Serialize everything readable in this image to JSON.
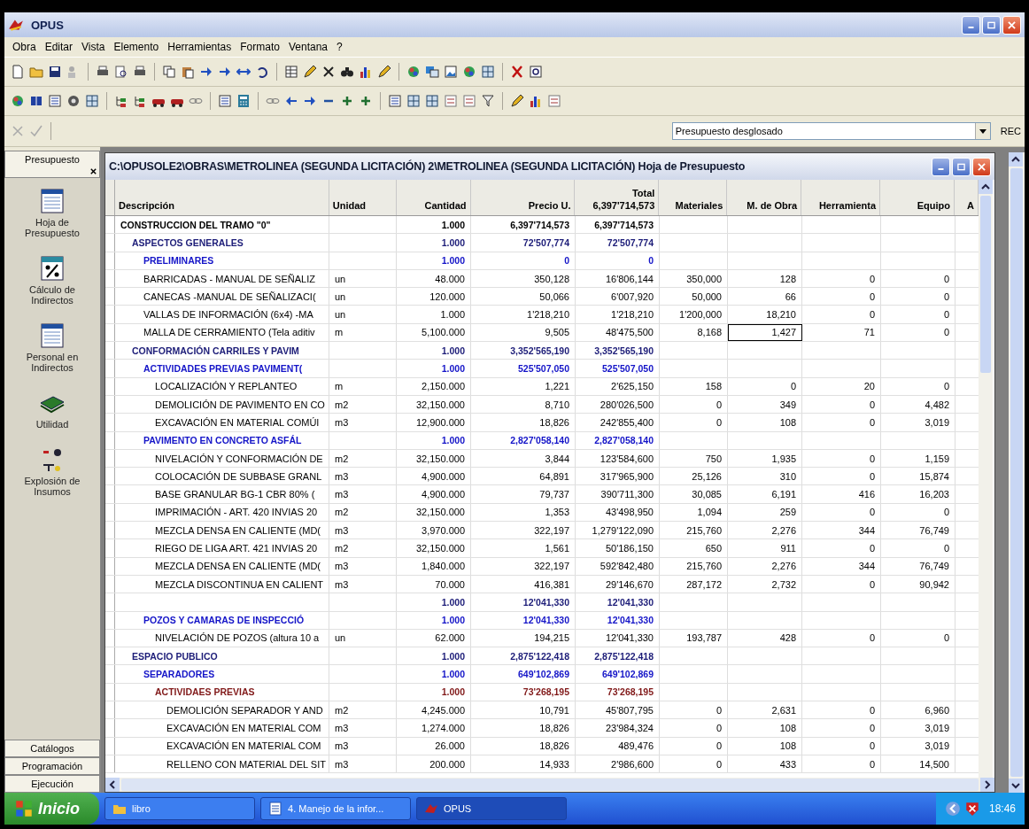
{
  "window": {
    "title": "OPUS"
  },
  "menu": [
    "Obra",
    "Editar",
    "Vista",
    "Elemento",
    "Herramientas",
    "Formato",
    "Ventana",
    "?"
  ],
  "view_selector": {
    "value": "Presupuesto desglosado"
  },
  "rec_label": "REC",
  "sidebar": {
    "top_tab": "Presupuesto",
    "items": [
      {
        "label": "Hoja de Presupuesto",
        "kind": "sheet"
      },
      {
        "label": "Cálculo de Indirectos",
        "kind": "percent"
      },
      {
        "label": "Personal en Indirectos",
        "kind": "sheet"
      },
      {
        "label": "Utilidad",
        "kind": "money"
      },
      {
        "label": "Explosión de Insumos",
        "kind": "explode"
      }
    ],
    "bottom_tabs": [
      "Catálogos",
      "Programación",
      "Ejecución"
    ]
  },
  "document": {
    "title": "C:\\OPUSOLE2\\OBRAS\\METROLINEA (SEGUNDA LICITACIÓN) 2\\METROLINEA (SEGUNDA LICITACIÓN) Hoja de Presupuesto",
    "columns": [
      {
        "label": "Descripción"
      },
      {
        "label": "Unidad"
      },
      {
        "label": "Cantidad"
      },
      {
        "label": "Precio U."
      },
      {
        "label": "Total",
        "subtotal": "6,397'714,573"
      },
      {
        "label": "Materiales"
      },
      {
        "label": "M. de Obra"
      },
      {
        "label": "Herramienta"
      },
      {
        "label": "Equipo"
      },
      {
        "label": "A"
      }
    ],
    "rows": [
      {
        "kind": "group",
        "color": "#000000",
        "descripcion": "CONSTRUCCION DEL TRAMO \"0\"",
        "cantidad": "1.000",
        "precio": "6,397'714,573",
        "total": "6,397'714,573",
        "children": [
          {
            "kind": "group",
            "color": "#1c1c78",
            "descripcion": "ASPECTOS GENERALES",
            "cantidad": "1.000",
            "precio": "72'507,774",
            "total": "72'507,774",
            "children": [
              {
                "kind": "group",
                "color": "#1414c8",
                "descripcion": "PRELIMINARES",
                "cantidad": "1.000",
                "precio": "0",
                "total": "0"
              },
              {
                "kind": "item",
                "descripcion": "BARRICADAS - MANUAL DE SEÑALIZ",
                "unidad": "un",
                "cantidad": "48.000",
                "precio": "350,128",
                "total": "16'806,144",
                "materiales": "350,000",
                "mano_obra": "128",
                "herramienta": "0",
                "equipo": "0",
                "mano_obra_focused": false
              },
              {
                "kind": "item",
                "descripcion": "CANECAS -MANUAL DE SEÑALIZACI(",
                "unidad": "un",
                "cantidad": "120.000",
                "precio": "50,066",
                "total": "6'007,920",
                "materiales": "50,000",
                "mano_obra": "66",
                "herramienta": "0",
                "equipo": "0",
                "mano_obra_focused": false
              },
              {
                "kind": "item",
                "descripcion": "VALLAS DE INFORMACIÓN (6x4) -MA",
                "unidad": "un",
                "cantidad": "1.000",
                "precio": "1'218,210",
                "total": "1'218,210",
                "materiales": "1'200,000",
                "mano_obra": "18,210",
                "herramienta": "0",
                "equipo": "0",
                "mano_obra_focused": false
              },
              {
                "kind": "item",
                "descripcion": "MALLA DE CERRAMIENTO (Tela aditiv",
                "unidad": "m",
                "cantidad": "5,100.000",
                "precio": "9,505",
                "total": "48'475,500",
                "materiales": "8,168",
                "mano_obra": "1,427",
                "herramienta": "71",
                "equipo": "0",
                "mano_obra_focused": true
              }
            ]
          },
          {
            "kind": "group",
            "color": "#1c1c78",
            "descripcion": "CONFORMACIÓN CARRILES Y PAVIM",
            "cantidad": "1.000",
            "precio": "3,352'565,190",
            "total": "3,352'565,190",
            "children": [
              {
                "kind": "group",
                "color": "#1414c8",
                "descripcion": "ACTIVIDADES PREVIAS PAVIMENT(",
                "cantidad": "1.000",
                "precio": "525'507,050",
                "total": "525'507,050",
                "children": [
                  {
                    "kind": "item",
                    "descripcion": "LOCALIZACIÓN Y REPLANTEO",
                    "unidad": "m",
                    "cantidad": "2,150.000",
                    "precio": "1,221",
                    "total": "2'625,150",
                    "materiales": "158",
                    "mano_obra": "0",
                    "herramienta": "20",
                    "equipo": "0",
                    "mano_obra_focused": false
                  },
                  {
                    "kind": "item",
                    "descripcion": "DEMOLICIÓN DE PAVIMENTO EN CO",
                    "unidad": "m2",
                    "cantidad": "32,150.000",
                    "precio": "8,710",
                    "total": "280'026,500",
                    "materiales": "0",
                    "mano_obra": "349",
                    "herramienta": "0",
                    "equipo": "4,482",
                    "mano_obra_focused": false
                  },
                  {
                    "kind": "item",
                    "descripcion": "EXCAVACIÓN EN MATERIAL COMÚI",
                    "unidad": "m3",
                    "cantidad": "12,900.000",
                    "precio": "18,826",
                    "total": "242'855,400",
                    "materiales": "0",
                    "mano_obra": "108",
                    "herramienta": "0",
                    "equipo": "3,019",
                    "mano_obra_focused": false
                  }
                ]
              },
              {
                "kind": "group",
                "color": "#1414c8",
                "descripcion": "PAVIMENTO EN CONCRETO ASFÁL",
                "cantidad": "1.000",
                "precio": "2,827'058,140",
                "total": "2,827'058,140",
                "children": [
                  {
                    "kind": "item",
                    "descripcion": "NIVELACIÓN Y CONFORMACIÓN DE",
                    "unidad": "m2",
                    "cantidad": "32,150.000",
                    "precio": "3,844",
                    "total": "123'584,600",
                    "materiales": "750",
                    "mano_obra": "1,935",
                    "herramienta": "0",
                    "equipo": "1,159",
                    "mano_obra_focused": false
                  },
                  {
                    "kind": "item",
                    "descripcion": "COLOCACIÓN DE SUBBASE GRANL",
                    "unidad": "m3",
                    "cantidad": "4,900.000",
                    "precio": "64,891",
                    "total": "317'965,900",
                    "materiales": "25,126",
                    "mano_obra": "310",
                    "herramienta": "0",
                    "equipo": "15,874",
                    "mano_obra_focused": false
                  },
                  {
                    "kind": "item",
                    "descripcion": "BASE GRANULAR BG-1 CBR 80% (",
                    "unidad": "m3",
                    "cantidad": "4,900.000",
                    "precio": "79,737",
                    "total": "390'711,300",
                    "materiales": "30,085",
                    "mano_obra": "6,191",
                    "herramienta": "416",
                    "equipo": "16,203",
                    "mano_obra_focused": false
                  },
                  {
                    "kind": "item",
                    "descripcion": "IMPRIMACIÓN - ART. 420 INVIAS 20",
                    "unidad": "m2",
                    "cantidad": "32,150.000",
                    "precio": "1,353",
                    "total": "43'498,950",
                    "materiales": "1,094",
                    "mano_obra": "259",
                    "herramienta": "0",
                    "equipo": "0",
                    "mano_obra_focused": false
                  },
                  {
                    "kind": "item",
                    "descripcion": "MEZCLA DENSA EN CALIENTE (MD(",
                    "unidad": "m3",
                    "cantidad": "3,970.000",
                    "precio": "322,197",
                    "total": "1,279'122,090",
                    "materiales": "215,760",
                    "mano_obra": "2,276",
                    "herramienta": "344",
                    "equipo": "76,749",
                    "mano_obra_focused": false
                  },
                  {
                    "kind": "item",
                    "descripcion": "RIEGO DE LIGA ART. 421 INVIAS 20",
                    "unidad": "m2",
                    "cantidad": "32,150.000",
                    "precio": "1,561",
                    "total": "50'186,150",
                    "materiales": "650",
                    "mano_obra": "911",
                    "herramienta": "0",
                    "equipo": "0",
                    "mano_obra_focused": false
                  },
                  {
                    "kind": "item",
                    "descripcion": "MEZCLA DENSA EN CALIENTE (MD(",
                    "unidad": "m3",
                    "cantidad": "1,840.000",
                    "precio": "322,197",
                    "total": "592'842,480",
                    "materiales": "215,760",
                    "mano_obra": "2,276",
                    "herramienta": "344",
                    "equipo": "76,749",
                    "mano_obra_focused": false
                  },
                  {
                    "kind": "item",
                    "descripcion": "MEZCLA DISCONTINUA EN CALIENT",
                    "unidad": "m3",
                    "cantidad": "70.000",
                    "precio": "416,381",
                    "total": "29'146,670",
                    "materiales": "287,172",
                    "mano_obra": "2,732",
                    "herramienta": "0",
                    "equipo": "90,942",
                    "mano_obra_focused": false
                  }
                ]
              }
            ]
          },
          {
            "kind": "group",
            "color": "#1c1c78",
            "cantidad": "1.000",
            "precio": "12'041,330",
            "total": "12'041,330",
            "children": [
              {
                "kind": "group",
                "color": "#1414c8",
                "descripcion": "POZOS Y CAMARAS DE INSPECCIÓ",
                "cantidad": "1.000",
                "precio": "12'041,330",
                "total": "12'041,330",
                "children": [
                  {
                    "kind": "item",
                    "descripcion": "NIVELACIÓN DE POZOS (altura 10 a",
                    "unidad": "un",
                    "cantidad": "62.000",
                    "precio": "194,215",
                    "total": "12'041,330",
                    "materiales": "193,787",
                    "mano_obra": "428",
                    "herramienta": "0",
                    "equipo": "0",
                    "mano_obra_focused": false
                  }
                ]
              }
            ]
          },
          {
            "kind": "group",
            "color": "#1c1c78",
            "descripcion": "ESPACIO PUBLICO",
            "cantidad": "1.000",
            "precio": "2,875'122,418",
            "total": "2,875'122,418",
            "children": [
              {
                "kind": "group",
                "color": "#1414c8",
                "descripcion": "SEPARADORES",
                "cantidad": "1.000",
                "precio": "649'102,869",
                "total": "649'102,869",
                "children": [
                  {
                    "kind": "group",
                    "color": "#801818",
                    "descripcion": "ACTIVIDAES PREVIAS",
                    "cantidad": "1.000",
                    "precio": "73'268,195",
                    "total": "73'268,195",
                    "children": [
                      {
                        "kind": "item",
                        "descripcion": "DEMOLICIÓN SEPARADOR Y AND",
                        "unidad": "m2",
                        "cantidad": "4,245.000",
                        "precio": "10,791",
                        "total": "45'807,795",
                        "materiales": "0",
                        "mano_obra": "2,631",
                        "herramienta": "0",
                        "equipo": "6,960",
                        "mano_obra_focused": false
                      },
                      {
                        "kind": "item",
                        "descripcion": "EXCAVACIÓN EN MATERIAL COM",
                        "unidad": "m3",
                        "cantidad": "1,274.000",
                        "precio": "18,826",
                        "total": "23'984,324",
                        "materiales": "0",
                        "mano_obra": "108",
                        "herramienta": "0",
                        "equipo": "3,019",
                        "mano_obra_focused": false
                      },
                      {
                        "kind": "item",
                        "descripcion": "EXCAVACIÓN EN MATERIAL COM",
                        "unidad": "m3",
                        "cantidad": "26.000",
                        "precio": "18,826",
                        "total": "489,476",
                        "materiales": "0",
                        "mano_obra": "108",
                        "herramienta": "0",
                        "equipo": "3,019",
                        "mano_obra_focused": false
                      },
                      {
                        "kind": "item",
                        "descripcion": "RELLENO CON MATERIAL DEL SIT",
                        "unidad": "m3",
                        "cantidad": "200.000",
                        "precio": "14,933",
                        "total": "2'986,600",
                        "materiales": "0",
                        "mano_obra": "433",
                        "herramienta": "0",
                        "equipo": "14,500",
                        "mano_obra_focused": false
                      }
                    ]
                  }
                ]
              }
            ]
          }
        ]
      }
    ]
  },
  "taskbar": {
    "start": "Inicio",
    "tasks": [
      {
        "label": "libro",
        "kind": "folder",
        "selected": false
      },
      {
        "label": "4. Manejo de la infor...",
        "kind": "document",
        "selected": false
      },
      {
        "label": "OPUS",
        "kind": "app",
        "selected": true
      }
    ],
    "clock": "18:46"
  }
}
